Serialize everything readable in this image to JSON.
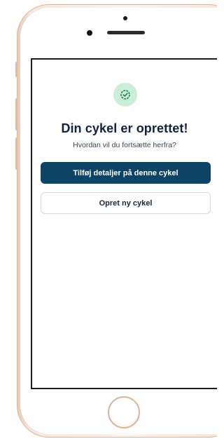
{
  "device": {
    "frame_color": "#f4e2d6",
    "accent_color": "#d9b49f"
  },
  "screen": {
    "success_icon": "check-circle-icon",
    "success_color": "#1f7a4a",
    "title": "Din cykel er oprettet!",
    "subtitle": "Hvordan vil du fortsætte herfra?",
    "primary_button_label": "Tilføj detaljer på denne cykel",
    "primary_button_color": "#0d4365",
    "secondary_button_label": "Opret ny cykel"
  }
}
